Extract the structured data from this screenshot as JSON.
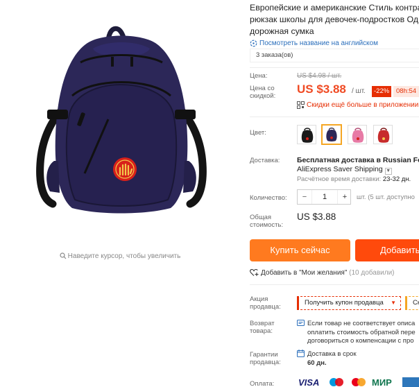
{
  "title": {
    "line1": "Европейские и американские Стиль контра",
    "line2": "рюкзак школы для девочек-подростков Од",
    "line3": "дорожная сумка"
  },
  "translate_link": "Посмотреть название на английском",
  "orders": "3 заказа(ов)",
  "price": {
    "label": "Цена:",
    "old": "US $4.98 / шт.",
    "discount_label_1": "Цена со",
    "discount_label_2": "скидкой:",
    "current": "US $3.88",
    "unit": "/ шт.",
    "discount_badge": "-22%",
    "timer": "08h:54",
    "app_deal": "Скидки ещё больше в приложении"
  },
  "color": {
    "label": "Цвет:",
    "selected_index": 1,
    "options": [
      "black",
      "navy",
      "pink",
      "red"
    ]
  },
  "shipping": {
    "label": "Доставка:",
    "line1": "Бесплатная доставка в Russian Fede",
    "line2": "AliExpress Saver Shipping",
    "time_label": "Расчётное время доставки:",
    "time_value": "23-32 дн."
  },
  "quantity": {
    "label": "Количество:",
    "minus": "−",
    "value": "1",
    "plus": "+",
    "available": "шт. (5 шт. доступно"
  },
  "total": {
    "label1": "Общая",
    "label2": "стоимость:",
    "value": "US $3.88"
  },
  "buttons": {
    "buy": "Купить сейчас",
    "cart": "Добавить в"
  },
  "wishlist": {
    "label": "Добавить в \"Мои желания\"",
    "count": "(10 добавили)"
  },
  "promo": {
    "label1": "Акция",
    "label2": "продавца:",
    "coupon": "Получить купон продавца",
    "coupon2": "Ск"
  },
  "returns": {
    "label1": "Возврат",
    "label2": "товара:",
    "line1": "Если товар не соответствует описа",
    "line2": "оплатить стоимость обратной пере",
    "line3": "договориться о компенсации с про"
  },
  "guarantee": {
    "label1": "Гарантии",
    "label2": "продавца:",
    "line1": "Доставка в срок",
    "line2": "60 дн."
  },
  "payment": {
    "label": "Оплата:",
    "methods": [
      "VISA",
      "Maestro",
      "Mastercard",
      "МИР",
      "AmEx"
    ]
  },
  "zoom_hint": "Наведите курсор, чтобы увеличить",
  "colors": {
    "accent": "#ff7a1f",
    "accent_dark": "#ff4a0c",
    "price_red": "#f04a23",
    "link_blue": "#2a6ebb",
    "bag_navy": "#2c2758"
  }
}
